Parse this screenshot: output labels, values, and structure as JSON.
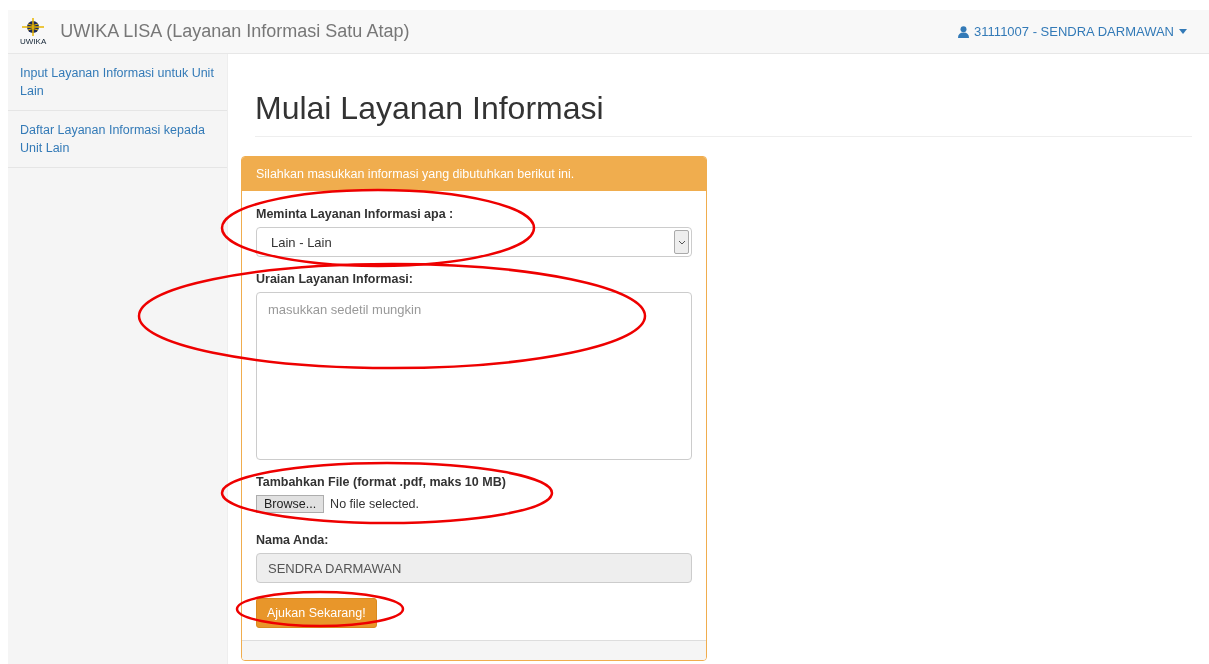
{
  "navbar": {
    "logo_text": "UWIKA",
    "brand": "UWIKA LISA (Layanan Informasi Satu Atap)",
    "user": "31111007 - SENDRA DARMAWAN"
  },
  "sidebar": {
    "items": [
      {
        "label": "Input Layanan Informasi untuk Unit Lain"
      },
      {
        "label": "Daftar Layanan Informasi kepada Unit Lain"
      }
    ]
  },
  "page_title": "Mulai Layanan Informasi",
  "panel": {
    "heading": "Silahkan masukkan informasi yang dibutuhkan berikut ini.",
    "fields": [
      {
        "kind": "select",
        "label": "Meminta Layanan Informasi apa :",
        "value": "Lain - Lain"
      },
      {
        "kind": "textarea",
        "label": "Uraian Layanan Informasi:",
        "placeholder": "masukkan sedetil mungkin"
      },
      {
        "kind": "file",
        "label": "Tambahkan File (format .pdf, maks 10 MB)",
        "button": "Browse...",
        "status": "No file selected."
      },
      {
        "kind": "text",
        "label": "Nama Anda:",
        "value": "SENDRA DARMAWAN",
        "disabled": true
      }
    ],
    "submit": "Ajukan Sekarang!"
  }
}
